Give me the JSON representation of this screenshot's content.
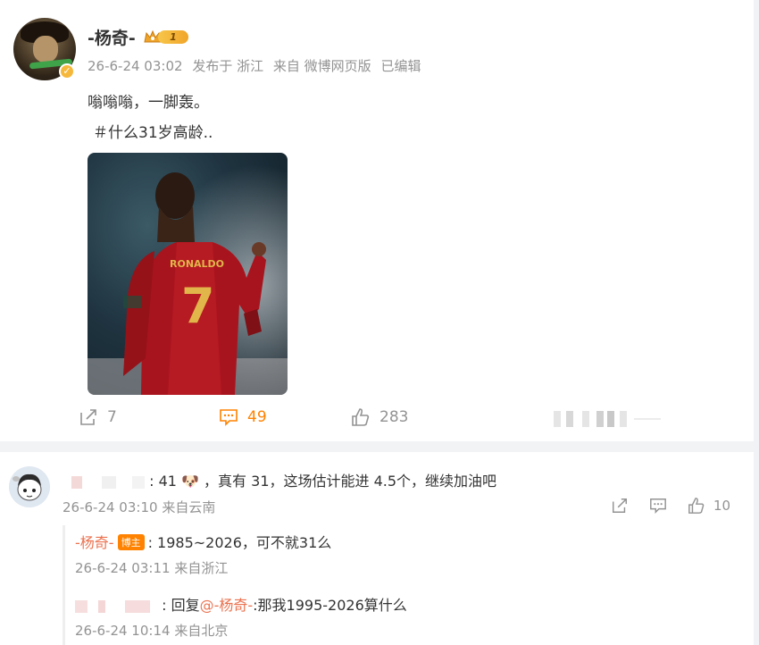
{
  "post": {
    "username": "-杨奇-",
    "level": "1",
    "time": "26-6-24 03:02",
    "location": "发布于 浙江",
    "source": "来自 微博网页版",
    "edited": "已编辑",
    "text_line1": "嗡嗡嗡，一脚轰。",
    "text_line2": "＃什么31岁高龄..",
    "jersey_name": "RONALDO",
    "jersey_number": "7"
  },
  "actions": {
    "share_count": "7",
    "comment_count": "49",
    "like_count": "283"
  },
  "comment": {
    "text": ": 41",
    "text_rest": "，真有 31，这场估计能进 4.5个，继续加油吧",
    "time": "26-6-24 03:10",
    "location": "来自云南",
    "like_count": "10"
  },
  "replies": [
    {
      "author": "-杨奇-",
      "badge": "博主",
      "text": ": 1985~2026，可不就31么",
      "time": "26-6-24 03:11",
      "location": "来自浙江"
    },
    {
      "prefix": ": 回复",
      "mention": "@-杨奇-",
      "text": ":那我1995-2026算什么",
      "time": "26-6-24 10:14",
      "location": "来自北京"
    }
  ],
  "colors": {
    "accent": "#ff8200",
    "mention": "#eb7350",
    "meta": "#939393"
  }
}
